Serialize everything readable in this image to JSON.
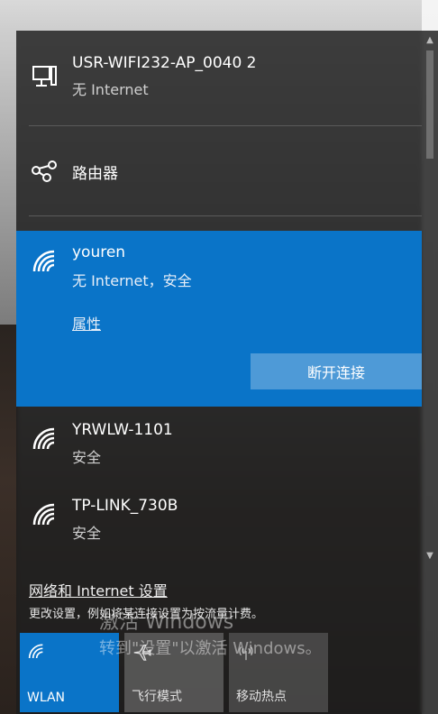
{
  "networks": [
    {
      "name": "USR-WIFI232-AP_0040  2",
      "status": "无 Internet",
      "icon": "ethernet-pc-icon"
    },
    {
      "name": "路由器",
      "icon": "router-icon"
    },
    {
      "name": "youren",
      "status": "无 Internet，安全",
      "icon": "wifi-icon",
      "properties": "属性",
      "disconnect": "断开连接"
    },
    {
      "name": "YRWLW-1101",
      "status": "安全",
      "icon": "wifi-icon"
    },
    {
      "name": "TP-LINK_730B",
      "status": "安全",
      "icon": "wifi-icon"
    }
  ],
  "settings": {
    "link": "网络和 Internet 设置",
    "desc": "更改设置，例如将某连接设置为按流量计费。"
  },
  "watermark": {
    "line1": "激活 Windows",
    "line2": "转到\"设置\"以激活 Windows。"
  },
  "quick_actions": [
    {
      "label": "WLAN",
      "icon": "wifi-icon",
      "active": true
    },
    {
      "label": "飞行模式",
      "icon": "airplane-icon",
      "active": false
    },
    {
      "label": "移动热点",
      "icon": "hotspot-icon",
      "active": false
    }
  ],
  "colors": {
    "accent": "#0a74c8",
    "panel": "#1c1c1c"
  }
}
